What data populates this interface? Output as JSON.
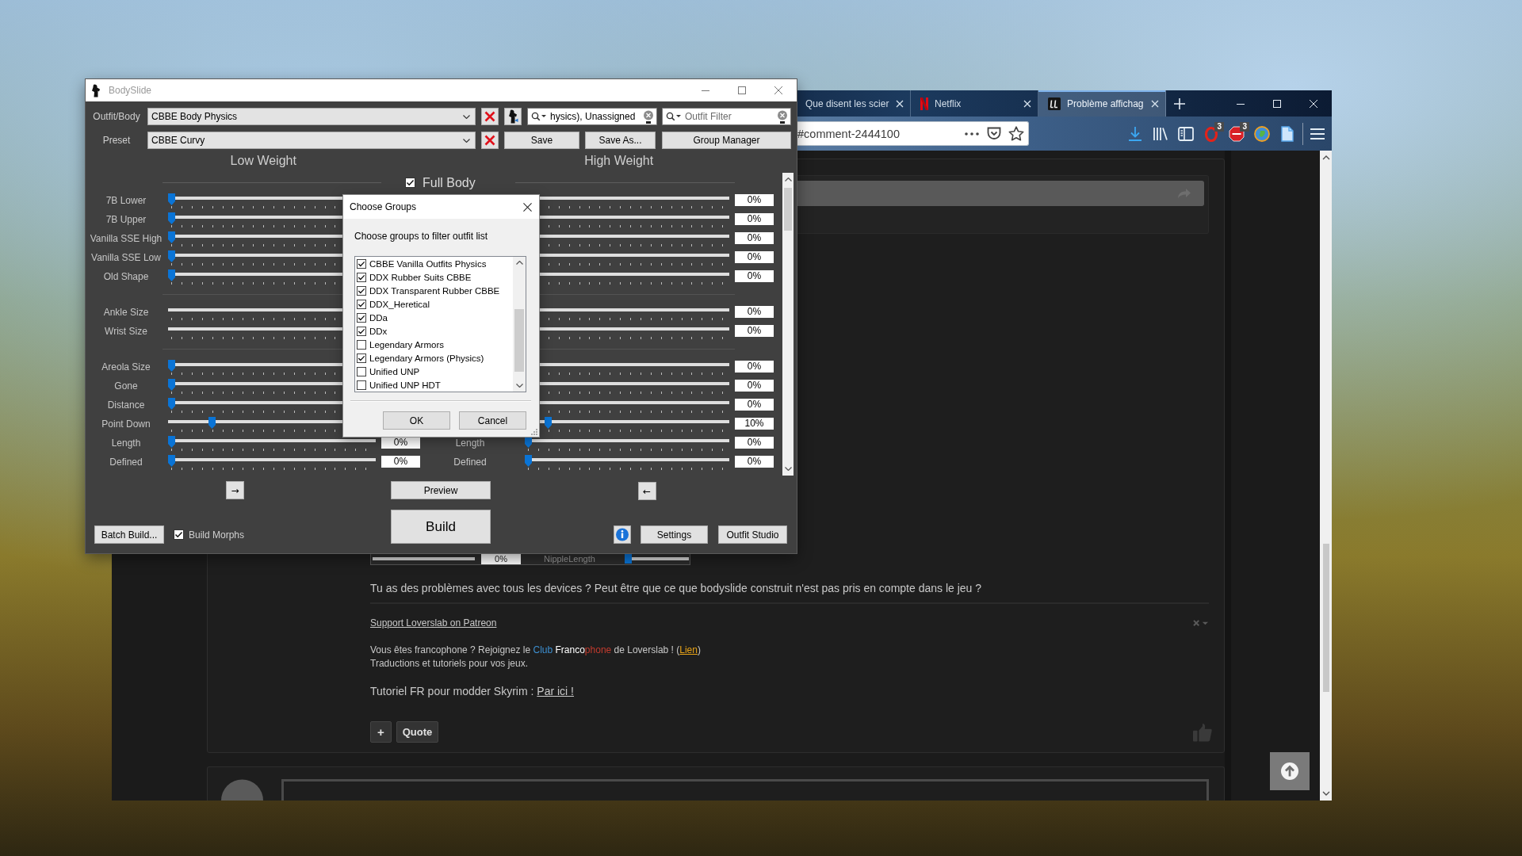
{
  "browser": {
    "tabs": [
      {
        "title": "Que disent les scier",
        "kind": "plain",
        "selected": false
      },
      {
        "title": "Netflix",
        "kind": "netflix",
        "selected": false
      },
      {
        "title": "Problème affichag",
        "kind": "forum",
        "selected": true
      }
    ],
    "address": "#comment-2444100",
    "extension_badges": [
      "3",
      "3"
    ],
    "post": {
      "screenshot": {
        "value": "0%",
        "label": "NippleLength",
        "level": 0
      },
      "text": "Tu as des problèmes avec tous les devices ? Peut être que ce que bodyslide construit n'est pas pris en compte dans le jeu ?",
      "signature_link": "Support Loverslab on Patreon",
      "signature_lines": [
        [
          {
            "text": "Vous êtes francophone ? Rejoignez le ",
            "color": "#c8c8c8",
            "kind": "text"
          },
          {
            "text": "Club ",
            "color": "#3d8fd0",
            "kind": "text"
          },
          {
            "text": "Franco",
            "color": "#ffffff",
            "kind": "text"
          },
          {
            "text": "phone",
            "color": "#c23b2e",
            "kind": "text"
          },
          {
            "text": " de Loverslab ! (",
            "color": "#c8c8c8",
            "kind": "text"
          },
          {
            "text": "Lien",
            "color": "#e8a317",
            "kind": "link"
          },
          {
            "text": ")",
            "color": "#c8c8c8",
            "kind": "text"
          }
        ],
        [
          {
            "text": "Traductions et tutoriels pour vos jeux.",
            "color": "#c8c8c8",
            "kind": "text"
          }
        ]
      ],
      "tutorial": {
        "text": "Tutoriel FR pour modder Skyrim :",
        "link": "Par ici !"
      },
      "buttons": [
        "+",
        "Quote"
      ]
    }
  },
  "bodyslide": {
    "title": "BodySlide",
    "outfit": {
      "label": "Outfit/Body",
      "value": "CBBE Body Physics"
    },
    "group_filter": {
      "value": "hysics), Unassigned"
    },
    "outfit_filter": {
      "placeholder": "Outfit Filter"
    },
    "preset": {
      "label": "Preset",
      "value": "CBBE Curvy"
    },
    "preset_buttons": [
      "Save",
      "Save As...",
      "Group Manager"
    ],
    "low_heading": "Low Weight",
    "high_heading": "High Weight",
    "full_body": {
      "label": "Full Body",
      "checked": true
    },
    "slider_groups": [
      {
        "sliders": [
          {
            "label": "7B Lower",
            "low": {
              "thumb": true,
              "level": 0
            },
            "high": {
              "value": "0%"
            }
          },
          {
            "label": "7B Upper",
            "low": {
              "thumb": true,
              "level": 0
            },
            "high": {
              "value": "0%"
            }
          },
          {
            "label": "Vanilla SSE High",
            "low": {
              "thumb": true,
              "level": 0
            },
            "high": {
              "value": "0%"
            }
          },
          {
            "label": "Vanilla SSE Low",
            "low": {
              "thumb": true,
              "level": 0
            },
            "high": {
              "value": "0%"
            }
          },
          {
            "label": "Old Shape",
            "low": {
              "thumb": true,
              "level": 0
            },
            "high": {
              "value": "0%"
            }
          }
        ]
      },
      {
        "sliders": [
          {
            "label": "Ankle Size",
            "low": {
              "thumb": false
            },
            "high": {
              "value": "0%"
            }
          },
          {
            "label": "Wrist Size",
            "low": {
              "thumb": false
            },
            "high": {
              "value": "0%"
            }
          }
        ]
      },
      {
        "sliders": [
          {
            "label": "Areola Size",
            "low": {
              "thumb": true,
              "level": 0
            },
            "high": {
              "value": "0%"
            }
          },
          {
            "label": "Gone",
            "low": {
              "thumb": true,
              "level": 0
            },
            "high": {
              "value": "0%"
            }
          },
          {
            "label": "Distance",
            "low": {
              "thumb": true,
              "level": 0
            },
            "high": {
              "value": "0%"
            }
          },
          {
            "label": "Point Down",
            "low": {
              "thumb": true,
              "level": 0.2
            },
            "high": {
              "thumb": true,
              "level": 0.1,
              "value": "10%"
            }
          },
          {
            "label": "Length",
            "low": {
              "thumb": true,
              "level": 0,
              "value": "0%"
            },
            "high_label": "Length",
            "high": {
              "thumb": true,
              "level": 0,
              "value": "0%"
            }
          },
          {
            "label": "Defined",
            "low": {
              "thumb": true,
              "level": 0,
              "value": "0%"
            },
            "high_label": "Defined",
            "high": {
              "thumb": true,
              "level": 0,
              "value": "0%"
            }
          }
        ]
      }
    ],
    "low_arrow": "→",
    "high_arrow": "←",
    "preview": "Preview",
    "build": "Build",
    "batch_build": "Batch Build...",
    "build_morphs": {
      "label": "Build Morphs",
      "checked": true
    },
    "settings": "Settings",
    "outfit_studio": "Outfit Studio"
  },
  "dialog": {
    "title": "Choose Groups",
    "prompt": "Choose groups to filter outfit list",
    "groups": [
      {
        "name": "CBBE Vanilla Outfits Physics",
        "checked": true
      },
      {
        "name": "DDX Rubber Suits CBBE",
        "checked": true
      },
      {
        "name": "DDX Transparent Rubber CBBE",
        "checked": true
      },
      {
        "name": "DDX_Heretical",
        "checked": true
      },
      {
        "name": "DDa",
        "checked": true
      },
      {
        "name": "DDx",
        "checked": true
      },
      {
        "name": "Legendary Armors",
        "checked": false
      },
      {
        "name": "Legendary Armors (Physics)",
        "checked": true
      },
      {
        "name": "Unified UNP",
        "checked": false
      },
      {
        "name": "Unified UNP HDT",
        "checked": false
      }
    ],
    "buttons": [
      "OK",
      "Cancel"
    ]
  }
}
